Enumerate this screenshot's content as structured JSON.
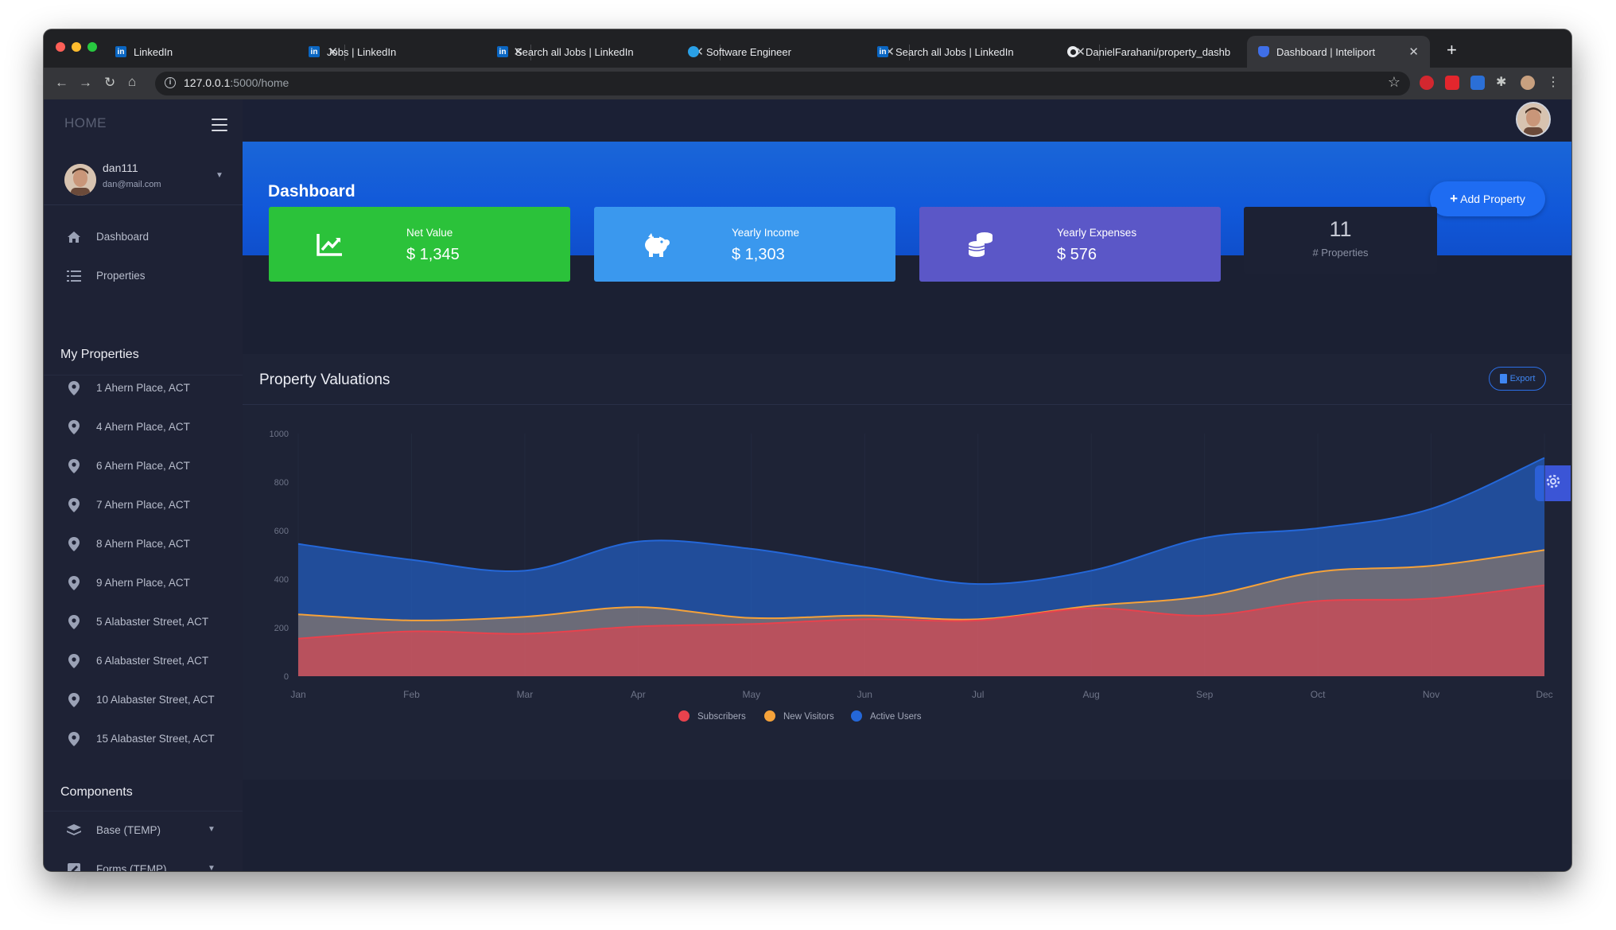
{
  "browser": {
    "tabs": [
      {
        "title": "LinkedIn",
        "favicon": "linkedin-icon"
      },
      {
        "title": "Jobs | LinkedIn",
        "favicon": "linkedin-icon"
      },
      {
        "title": "Search all Jobs | LinkedIn",
        "favicon": "linkedin-icon"
      },
      {
        "title": "Software Engineer",
        "favicon": "globe-icon"
      },
      {
        "title": "Search all Jobs | LinkedIn",
        "favicon": "linkedin-icon"
      },
      {
        "title": "DanielFarahani/property_dashb",
        "favicon": "github-icon"
      },
      {
        "title": "Dashboard | Inteliport",
        "favicon": "shield-icon"
      }
    ],
    "url_host": "127.0.0.1",
    "url_rest": ":5000/home"
  },
  "sidebar": {
    "brand": "HOME",
    "user": {
      "name": "dan111",
      "email": "dan@mail.com"
    },
    "nav": [
      {
        "label": "Dashboard",
        "icon": "home-icon"
      },
      {
        "label": "Properties",
        "icon": "list-icon"
      }
    ],
    "my_properties_heading": "My Properties",
    "properties": [
      "1 Ahern Place, ACT",
      "4 Ahern Place, ACT",
      "6 Ahern Place, ACT",
      "7 Ahern Place, ACT",
      "8 Ahern Place, ACT",
      "9 Ahern Place, ACT",
      "5 Alabaster Street, ACT",
      "6 Alabaster Street, ACT",
      "10 Alabaster Street, ACT",
      "15 Alabaster Street, ACT"
    ],
    "components_heading": "Components",
    "components": [
      {
        "label": "Base (TEMP)",
        "icon": "layers-icon"
      },
      {
        "label": "Forms (TEMP)",
        "icon": "edit-icon"
      }
    ]
  },
  "header": {
    "title": "Dashboard",
    "add_button": "Add Property"
  },
  "stats": [
    {
      "title": "Net Value",
      "value": "$ 1,345",
      "color": "#2bc23a",
      "icon": "trending-up-icon"
    },
    {
      "title": "Yearly Income",
      "value": "$ 1,303",
      "color": "#3a98ee",
      "icon": "piggy-bank-icon"
    },
    {
      "title": "Yearly Expenses",
      "value": "$ 576",
      "color": "#5b57c7",
      "icon": "coins-icon"
    }
  ],
  "property_count": {
    "value": "11",
    "label": "# Properties"
  },
  "panel": {
    "title": "Property Valuations",
    "export_label": "Export"
  },
  "chart_data": {
    "type": "area",
    "categories": [
      "Jan",
      "Feb",
      "Mar",
      "Apr",
      "May",
      "Jun",
      "Jul",
      "Aug",
      "Sep",
      "Oct",
      "Nov",
      "Dec"
    ],
    "ylim": [
      0,
      1000
    ],
    "yticks": [
      0,
      200,
      400,
      600,
      800,
      1000
    ],
    "series": [
      {
        "name": "Subscribers",
        "color": "#e8424d",
        "values": [
          155,
          185,
          175,
          205,
          215,
          235,
          230,
          280,
          250,
          310,
          320,
          375
        ]
      },
      {
        "name": "New Visitors",
        "color": "#f5a23a",
        "values": [
          255,
          230,
          245,
          285,
          240,
          250,
          235,
          290,
          330,
          430,
          455,
          520
        ]
      },
      {
        "name": "Active Users",
        "color": "#2467d8",
        "values": [
          545,
          480,
          435,
          555,
          525,
          450,
          380,
          435,
          570,
          610,
          690,
          900
        ]
      }
    ],
    "legend_position": "bottom-center",
    "grid": true
  }
}
